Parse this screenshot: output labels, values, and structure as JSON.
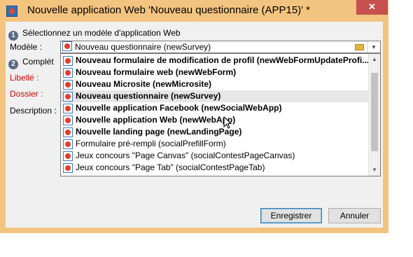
{
  "window": {
    "title": "Nouvelle application Web 'Nouveau questionnaire (APP15)' *",
    "close_label": "✕"
  },
  "steps": [
    {
      "number": "1",
      "label": "Sélectionnez un modèle d'application Web"
    },
    {
      "number": "2",
      "label": "Complét"
    }
  ],
  "form": {
    "modele_label": "Modèle :",
    "libelle_label": "Libellé :",
    "dossier_label": "Dossier :",
    "description_label": "Description :"
  },
  "combo": {
    "value": "Nouveau questionnaire (newSurvey)",
    "folder_icon": "folder-icon",
    "arrow": "▾"
  },
  "dropdown": {
    "items": [
      {
        "label": "Nouveau formulaire de modification de profil (newWebFormUpdateProfi...",
        "bold": true
      },
      {
        "label": "Nouveau formulaire web (newWebForm)",
        "bold": true
      },
      {
        "label": "Nouveau Microsite (newMicrosite)",
        "bold": true
      },
      {
        "label": "Nouveau questionnaire (newSurvey)",
        "bold": true,
        "selected": true
      },
      {
        "label": "Nouvelle application Facebook (newSocialWebApp)",
        "bold": true
      },
      {
        "label": "Nouvelle application Web (newWebApp)",
        "bold": true
      },
      {
        "label": "Nouvelle landing page (newLandingPage)",
        "bold": true
      },
      {
        "label": "Formulaire pré-rempli (socialPrefillForm)",
        "bold": false
      },
      {
        "label": "Jeux concours \"Page Canvas\" (socialContestPageCanvas)",
        "bold": false
      },
      {
        "label": "Jeux concours \"Page Tab\" (socialContestPageTab)",
        "bold": false
      }
    ]
  },
  "buttons": {
    "save": "Enregistrer",
    "cancel": "Annuler"
  },
  "colors": {
    "window_frame": "#f3c47f",
    "close_button": "#c7504f",
    "required_label": "#d40000"
  }
}
